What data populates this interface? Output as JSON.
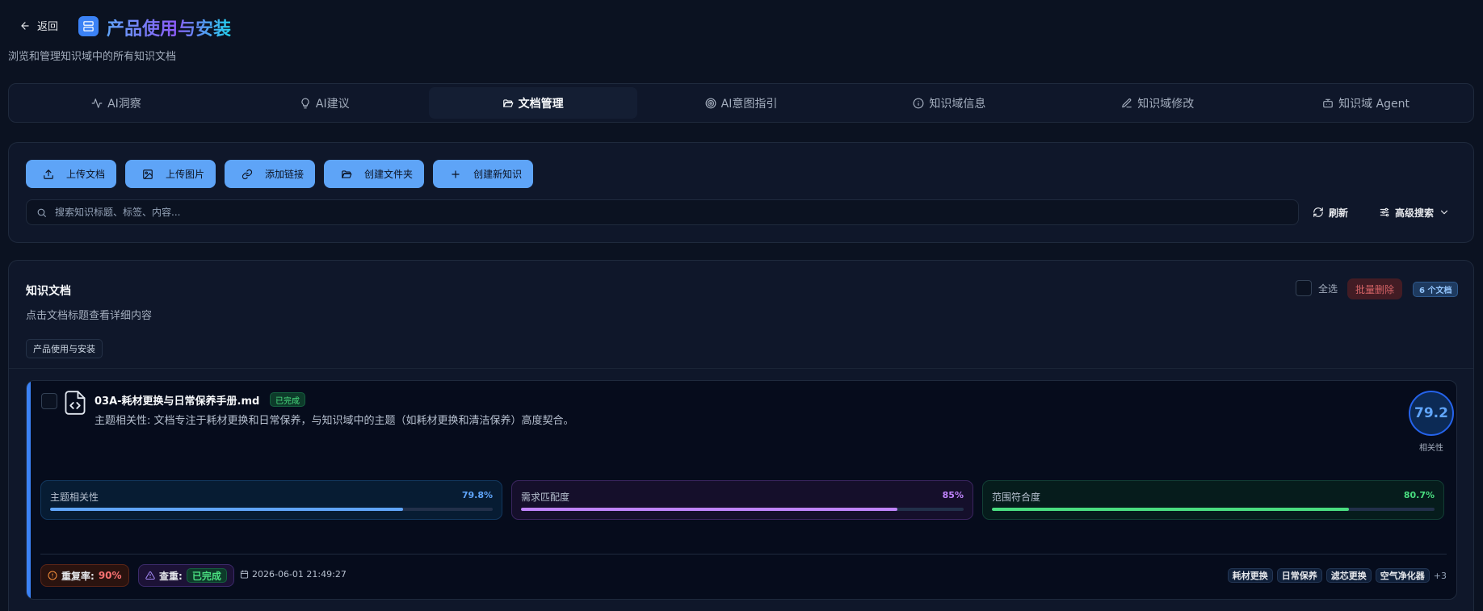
{
  "header": {
    "back_label": "返回",
    "title": "产品使用与安装",
    "subtitle": "浏览和管理知识域中的所有知识文档"
  },
  "tabs": [
    {
      "label": "AI洞察",
      "icon": "activity-icon"
    },
    {
      "label": "AI建议",
      "icon": "lightbulb-icon"
    },
    {
      "label": "文档管理",
      "icon": "folder-open-icon",
      "active": true
    },
    {
      "label": "AI意图指引",
      "icon": "target-icon"
    },
    {
      "label": "知识域信息",
      "icon": "info-icon"
    },
    {
      "label": "知识域修改",
      "icon": "pencil-icon"
    },
    {
      "label": "知识域 Agent",
      "icon": "bot-icon"
    }
  ],
  "toolbar": {
    "upload_doc": "上传文档",
    "upload_image": "上传图片",
    "add_link": "添加链接",
    "create_folder": "创建文件夹",
    "create_knowledge": "创建新知识",
    "search_placeholder": "搜索知识标题、标签、内容...",
    "refresh": "刷新",
    "advanced_search": "高级搜索"
  },
  "docs": {
    "title": "知识文档",
    "subtitle": "点击文档标题查看详细内容",
    "select_all": "全选",
    "bulk_delete": "批量删除",
    "count_badge": "6 个文档",
    "domain_chip": "产品使用与安装"
  },
  "document": {
    "name": "03A-耗材更换与日常保养手册.md",
    "status": "已完成",
    "description": "主题相关性: 文档专注于耗材更换和日常保养，与知识域中的主题（如耗材更换和清洁保养）高度契合。",
    "score": "79.2",
    "score_label": "相关性",
    "metrics": [
      {
        "label": "主题相关性",
        "value_text": "79.8%",
        "value": 79.8,
        "color": "#60a5fa"
      },
      {
        "label": "需求匹配度",
        "value_text": "85%",
        "value": 85,
        "color": "#c084fc"
      },
      {
        "label": "范围符合度",
        "value_text": "80.7%",
        "value": 80.7,
        "color": "#4ade80"
      }
    ],
    "dup_label": "重复率:",
    "dup_value": "90%",
    "check_label": "查重:",
    "check_value": "已完成",
    "date": "2026-06-01 21:49:27",
    "tags": [
      "耗材更换",
      "日常保养",
      "滤芯更换",
      "空气净化器"
    ],
    "tags_more": "+3"
  }
}
